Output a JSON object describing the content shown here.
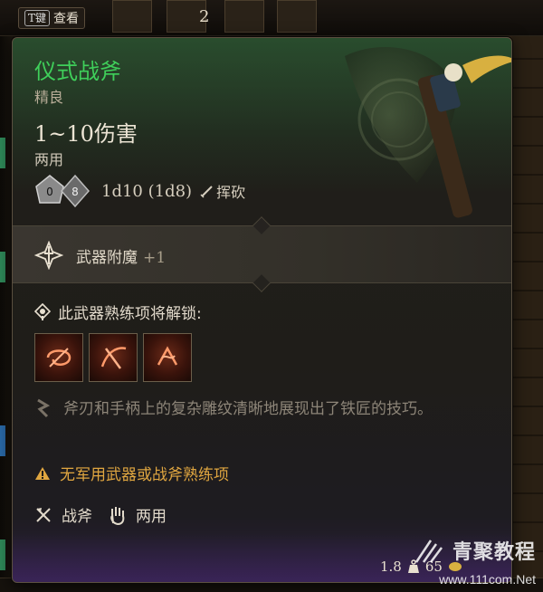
{
  "hotbar": {
    "hotkey_badge": "T键",
    "hotkey_label": "查看",
    "slot_count": "2"
  },
  "tooltip": {
    "title": "仪式战斧",
    "rarity": "精良",
    "damage": "1~10伤害",
    "handedness": "两用",
    "dice": {
      "die1": "0",
      "die2": "8",
      "formula": "1d10 (1d8)"
    },
    "attack_type": "挥砍",
    "enchant": {
      "label": "武器附魔",
      "bonus": "+1"
    },
    "unlock_heading": "此武器熟练项将解锁:",
    "skills": [
      "skill-1",
      "skill-2",
      "skill-3"
    ],
    "lore": "斧刃和手柄上的复杂雕纹清晰地展现出了铁匠的技巧。",
    "warning": "无军用武器或战斧熟练项",
    "tags": {
      "weapon_type": "战斧",
      "grip": "两用"
    },
    "footer": {
      "weight": "1.8",
      "value": "65"
    }
  },
  "watermark": {
    "title": "青聚教程",
    "url": "www.111com.Net"
  },
  "colors": {
    "title": "#3fcf5a",
    "warning": "#e0a640",
    "lore": "#8d8578",
    "header_glow": "#2e8c46"
  },
  "icons": [
    "axe-art",
    "dice-icon",
    "slash-icon",
    "enchant-icon",
    "unlock-icon",
    "lore-icon",
    "warning-icon",
    "axe-type-icon",
    "hand-icon",
    "weight-icon",
    "coin-icon"
  ]
}
